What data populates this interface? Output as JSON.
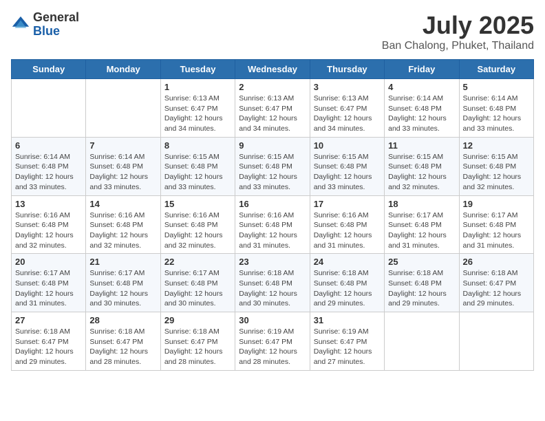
{
  "logo": {
    "general": "General",
    "blue": "Blue"
  },
  "header": {
    "title": "July 2025",
    "subtitle": "Ban Chalong, Phuket, Thailand"
  },
  "weekdays": [
    "Sunday",
    "Monday",
    "Tuesday",
    "Wednesday",
    "Thursday",
    "Friday",
    "Saturday"
  ],
  "weeks": [
    [
      {
        "day": "",
        "sunrise": "",
        "sunset": "",
        "daylight": ""
      },
      {
        "day": "",
        "sunrise": "",
        "sunset": "",
        "daylight": ""
      },
      {
        "day": "1",
        "sunrise": "Sunrise: 6:13 AM",
        "sunset": "Sunset: 6:47 PM",
        "daylight": "Daylight: 12 hours and 34 minutes."
      },
      {
        "day": "2",
        "sunrise": "Sunrise: 6:13 AM",
        "sunset": "Sunset: 6:47 PM",
        "daylight": "Daylight: 12 hours and 34 minutes."
      },
      {
        "day": "3",
        "sunrise": "Sunrise: 6:13 AM",
        "sunset": "Sunset: 6:47 PM",
        "daylight": "Daylight: 12 hours and 34 minutes."
      },
      {
        "day": "4",
        "sunrise": "Sunrise: 6:14 AM",
        "sunset": "Sunset: 6:48 PM",
        "daylight": "Daylight: 12 hours and 33 minutes."
      },
      {
        "day": "5",
        "sunrise": "Sunrise: 6:14 AM",
        "sunset": "Sunset: 6:48 PM",
        "daylight": "Daylight: 12 hours and 33 minutes."
      }
    ],
    [
      {
        "day": "6",
        "sunrise": "Sunrise: 6:14 AM",
        "sunset": "Sunset: 6:48 PM",
        "daylight": "Daylight: 12 hours and 33 minutes."
      },
      {
        "day": "7",
        "sunrise": "Sunrise: 6:14 AM",
        "sunset": "Sunset: 6:48 PM",
        "daylight": "Daylight: 12 hours and 33 minutes."
      },
      {
        "day": "8",
        "sunrise": "Sunrise: 6:15 AM",
        "sunset": "Sunset: 6:48 PM",
        "daylight": "Daylight: 12 hours and 33 minutes."
      },
      {
        "day": "9",
        "sunrise": "Sunrise: 6:15 AM",
        "sunset": "Sunset: 6:48 PM",
        "daylight": "Daylight: 12 hours and 33 minutes."
      },
      {
        "day": "10",
        "sunrise": "Sunrise: 6:15 AM",
        "sunset": "Sunset: 6:48 PM",
        "daylight": "Daylight: 12 hours and 33 minutes."
      },
      {
        "day": "11",
        "sunrise": "Sunrise: 6:15 AM",
        "sunset": "Sunset: 6:48 PM",
        "daylight": "Daylight: 12 hours and 32 minutes."
      },
      {
        "day": "12",
        "sunrise": "Sunrise: 6:15 AM",
        "sunset": "Sunset: 6:48 PM",
        "daylight": "Daylight: 12 hours and 32 minutes."
      }
    ],
    [
      {
        "day": "13",
        "sunrise": "Sunrise: 6:16 AM",
        "sunset": "Sunset: 6:48 PM",
        "daylight": "Daylight: 12 hours and 32 minutes."
      },
      {
        "day": "14",
        "sunrise": "Sunrise: 6:16 AM",
        "sunset": "Sunset: 6:48 PM",
        "daylight": "Daylight: 12 hours and 32 minutes."
      },
      {
        "day": "15",
        "sunrise": "Sunrise: 6:16 AM",
        "sunset": "Sunset: 6:48 PM",
        "daylight": "Daylight: 12 hours and 32 minutes."
      },
      {
        "day": "16",
        "sunrise": "Sunrise: 6:16 AM",
        "sunset": "Sunset: 6:48 PM",
        "daylight": "Daylight: 12 hours and 31 minutes."
      },
      {
        "day": "17",
        "sunrise": "Sunrise: 6:16 AM",
        "sunset": "Sunset: 6:48 PM",
        "daylight": "Daylight: 12 hours and 31 minutes."
      },
      {
        "day": "18",
        "sunrise": "Sunrise: 6:17 AM",
        "sunset": "Sunset: 6:48 PM",
        "daylight": "Daylight: 12 hours and 31 minutes."
      },
      {
        "day": "19",
        "sunrise": "Sunrise: 6:17 AM",
        "sunset": "Sunset: 6:48 PM",
        "daylight": "Daylight: 12 hours and 31 minutes."
      }
    ],
    [
      {
        "day": "20",
        "sunrise": "Sunrise: 6:17 AM",
        "sunset": "Sunset: 6:48 PM",
        "daylight": "Daylight: 12 hours and 31 minutes."
      },
      {
        "day": "21",
        "sunrise": "Sunrise: 6:17 AM",
        "sunset": "Sunset: 6:48 PM",
        "daylight": "Daylight: 12 hours and 30 minutes."
      },
      {
        "day": "22",
        "sunrise": "Sunrise: 6:17 AM",
        "sunset": "Sunset: 6:48 PM",
        "daylight": "Daylight: 12 hours and 30 minutes."
      },
      {
        "day": "23",
        "sunrise": "Sunrise: 6:18 AM",
        "sunset": "Sunset: 6:48 PM",
        "daylight": "Daylight: 12 hours and 30 minutes."
      },
      {
        "day": "24",
        "sunrise": "Sunrise: 6:18 AM",
        "sunset": "Sunset: 6:48 PM",
        "daylight": "Daylight: 12 hours and 29 minutes."
      },
      {
        "day": "25",
        "sunrise": "Sunrise: 6:18 AM",
        "sunset": "Sunset: 6:48 PM",
        "daylight": "Daylight: 12 hours and 29 minutes."
      },
      {
        "day": "26",
        "sunrise": "Sunrise: 6:18 AM",
        "sunset": "Sunset: 6:47 PM",
        "daylight": "Daylight: 12 hours and 29 minutes."
      }
    ],
    [
      {
        "day": "27",
        "sunrise": "Sunrise: 6:18 AM",
        "sunset": "Sunset: 6:47 PM",
        "daylight": "Daylight: 12 hours and 29 minutes."
      },
      {
        "day": "28",
        "sunrise": "Sunrise: 6:18 AM",
        "sunset": "Sunset: 6:47 PM",
        "daylight": "Daylight: 12 hours and 28 minutes."
      },
      {
        "day": "29",
        "sunrise": "Sunrise: 6:18 AM",
        "sunset": "Sunset: 6:47 PM",
        "daylight": "Daylight: 12 hours and 28 minutes."
      },
      {
        "day": "30",
        "sunrise": "Sunrise: 6:19 AM",
        "sunset": "Sunset: 6:47 PM",
        "daylight": "Daylight: 12 hours and 28 minutes."
      },
      {
        "day": "31",
        "sunrise": "Sunrise: 6:19 AM",
        "sunset": "Sunset: 6:47 PM",
        "daylight": "Daylight: 12 hours and 27 minutes."
      },
      {
        "day": "",
        "sunrise": "",
        "sunset": "",
        "daylight": ""
      },
      {
        "day": "",
        "sunrise": "",
        "sunset": "",
        "daylight": ""
      }
    ]
  ]
}
